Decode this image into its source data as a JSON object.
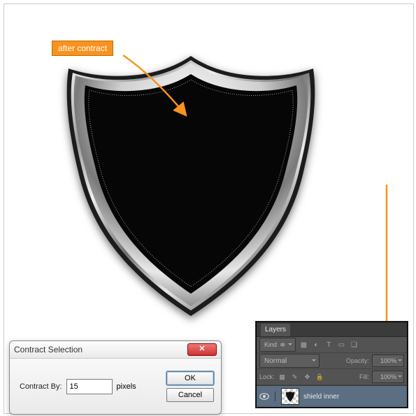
{
  "annotation": {
    "label": "after contract"
  },
  "dialog": {
    "title": "Contract Selection",
    "field_label": "Contract By:",
    "value": "15",
    "unit": "pixels",
    "ok": "OK",
    "cancel": "Cancel"
  },
  "layers": {
    "panel_title": "Layers",
    "kind_label": "Kind",
    "blend_mode": "Normal",
    "opacity_label": "Opacity:",
    "opacity_value": "100%",
    "lock_label": "Lock:",
    "fill_label": "Fill:",
    "fill_value": "100%",
    "item_name": "shield inner"
  }
}
